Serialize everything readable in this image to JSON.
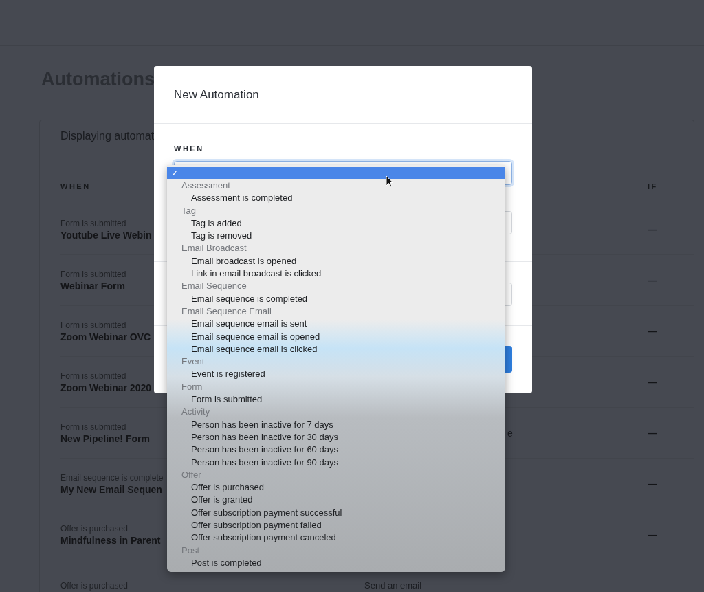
{
  "page": {
    "title": "Automations",
    "subtitle": "Displaying automat",
    "columns": [
      {
        "label": "WHEN"
      },
      {
        "label": "IF"
      }
    ],
    "rows": [
      {
        "trigger": "Form is submitted",
        "name": "Youtube Live Webin",
        "action": "",
        "condition": "—"
      },
      {
        "trigger": "Form is submitted",
        "name": "Webinar Form",
        "action": "",
        "condition": "—"
      },
      {
        "trigger": "Form is submitted",
        "name": "Zoom Webinar OVC",
        "action": "",
        "condition": "—"
      },
      {
        "trigger": "Form is submitted",
        "name": "Zoom Webinar 2020",
        "action": "",
        "condition": "—"
      },
      {
        "trigger": "Form is submitted",
        "name": "New Pipeline! Form",
        "action": "e",
        "condition": "—"
      },
      {
        "trigger": "Email sequence is complete",
        "name": "My New Email Sequen",
        "action": "",
        "condition": "—"
      },
      {
        "trigger": "Offer is purchased",
        "name": "Mindfulness in Parent",
        "action": "",
        "condition": "—"
      },
      {
        "trigger": "Offer is purchased",
        "name": "",
        "action": "Send an email",
        "condition": ""
      }
    ]
  },
  "modal": {
    "title": "New Automation",
    "when_label": "WHEN"
  },
  "dropdown": {
    "selected_option": {
      "check": "✓",
      "selected": true
    },
    "groups": [
      {
        "label": "Assessment",
        "options": [
          {
            "label": "Assessment is completed",
            "selected": false
          }
        ]
      },
      {
        "label": "Tag",
        "options": [
          {
            "label": "Tag is added",
            "selected": false
          },
          {
            "label": "Tag is removed",
            "selected": false
          }
        ]
      },
      {
        "label": "Email Broadcast",
        "options": [
          {
            "label": "Email broadcast is opened",
            "selected": false
          },
          {
            "label": "Link in email broadcast is clicked",
            "selected": false
          }
        ]
      },
      {
        "label": "Email Sequence",
        "options": [
          {
            "label": "Email sequence is completed",
            "selected": false
          }
        ]
      },
      {
        "label": "Email Sequence Email",
        "options": [
          {
            "label": "Email sequence email is sent",
            "selected": false
          },
          {
            "label": "Email sequence email is opened",
            "selected": false
          },
          {
            "label": "Email sequence email is clicked",
            "selected": false
          }
        ]
      },
      {
        "label": "Event",
        "options": [
          {
            "label": "Event is registered",
            "selected": false
          }
        ]
      },
      {
        "label": "Form",
        "options": [
          {
            "label": "Form is submitted",
            "selected": false
          }
        ]
      },
      {
        "label": "Activity",
        "options": [
          {
            "label": "Person has been inactive for 7 days",
            "selected": false
          },
          {
            "label": "Person has been inactive for 30 days",
            "selected": false
          },
          {
            "label": "Person has been inactive for 60 days",
            "selected": false
          },
          {
            "label": "Person has been inactive for 90 days",
            "selected": false
          }
        ]
      },
      {
        "label": "Offer",
        "options": [
          {
            "label": "Offer is purchased",
            "selected": false
          },
          {
            "label": "Offer is granted",
            "selected": false
          },
          {
            "label": "Offer subscription payment successful",
            "selected": false
          },
          {
            "label": "Offer subscription payment failed",
            "selected": false
          },
          {
            "label": "Offer subscription payment canceled",
            "selected": false
          }
        ]
      },
      {
        "label": "Post",
        "options": [
          {
            "label": "Post is completed",
            "selected": false
          }
        ]
      }
    ]
  }
}
